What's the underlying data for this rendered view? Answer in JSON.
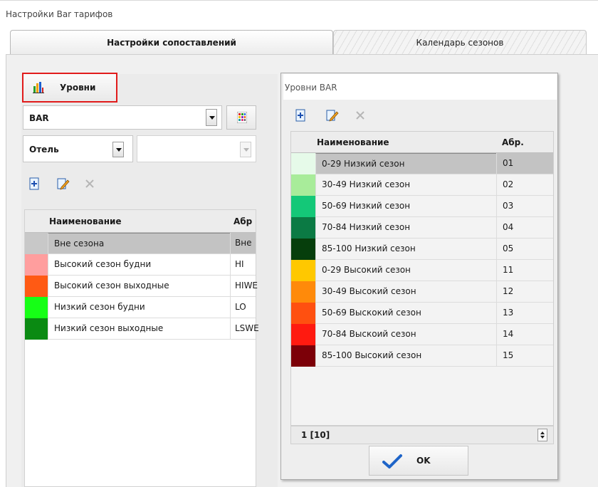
{
  "window": {
    "title": "Настройки Bar тарифов"
  },
  "tabs": [
    {
      "label": "Настройки сопоставлений",
      "active": true
    },
    {
      "label": "Календарь сезонов",
      "active": false
    }
  ],
  "left": {
    "levels_button": {
      "label": "Уровни",
      "icon": "bar-chart-icon",
      "highlight_color": "#e11b1b"
    },
    "bar_select": {
      "value": "BAR"
    },
    "hotel_select": {
      "value": "Отель"
    },
    "second_select": {
      "value": ""
    },
    "toolbar": {
      "add": "add-record-icon",
      "edit": "edit-record-icon",
      "delete": "delete-record-icon"
    },
    "grid": {
      "columns": [
        "Наименование",
        "Абр"
      ],
      "rows": [
        {
          "color": "#c8c8c8",
          "name": "Вне сезона",
          "abbr": "Вне",
          "selected": true
        },
        {
          "color": "#ff9e9e",
          "name": "Высокий сезон будни",
          "abbr": "HI"
        },
        {
          "color": "#ff5a14",
          "name": "Высокий сезон выходные",
          "abbr": "HIWE"
        },
        {
          "color": "#16ff16",
          "name": "Низкий сезон будни",
          "abbr": "LO"
        },
        {
          "color": "#0a8a12",
          "name": "Низкий сезон выходные",
          "abbr": "LSWE"
        }
      ]
    }
  },
  "dialog": {
    "title": "Уровни BAR",
    "toolbar": {
      "add": "add-record-icon",
      "edit": "edit-record-icon",
      "delete": "delete-record-icon"
    },
    "grid": {
      "columns": [
        "Наименование",
        "Абр."
      ],
      "rows": [
        {
          "color": "#e6fae9",
          "name": "0-29 Низкий сезон",
          "abbr": "01",
          "selected": true
        },
        {
          "color": "#a8ec9a",
          "name": "30-49 Низкий сезон",
          "abbr": "02"
        },
        {
          "color": "#14c878",
          "name": "50-69 Низкий сезон",
          "abbr": "03"
        },
        {
          "color": "#0b7a44",
          "name": "70-84 Низкий сезон",
          "abbr": "04"
        },
        {
          "color": "#063e0c",
          "name": "85-100 Низкий сезон",
          "abbr": "05"
        },
        {
          "color": "#ffc800",
          "name": "0-29 Высокий сезон",
          "abbr": "11"
        },
        {
          "color": "#ff8a0a",
          "name": "30-49 Высокий сезон",
          "abbr": "12"
        },
        {
          "color": "#ff5010",
          "name": "50-69 Выскокий сезон",
          "abbr": "13"
        },
        {
          "color": "#ff1a10",
          "name": "70-84 Выскоий сезон",
          "abbr": "14"
        },
        {
          "color": "#7c0008",
          "name": "85-100 Высокий сезон",
          "abbr": "15"
        }
      ]
    },
    "status": "1 [10]",
    "ok_label": "OK"
  }
}
